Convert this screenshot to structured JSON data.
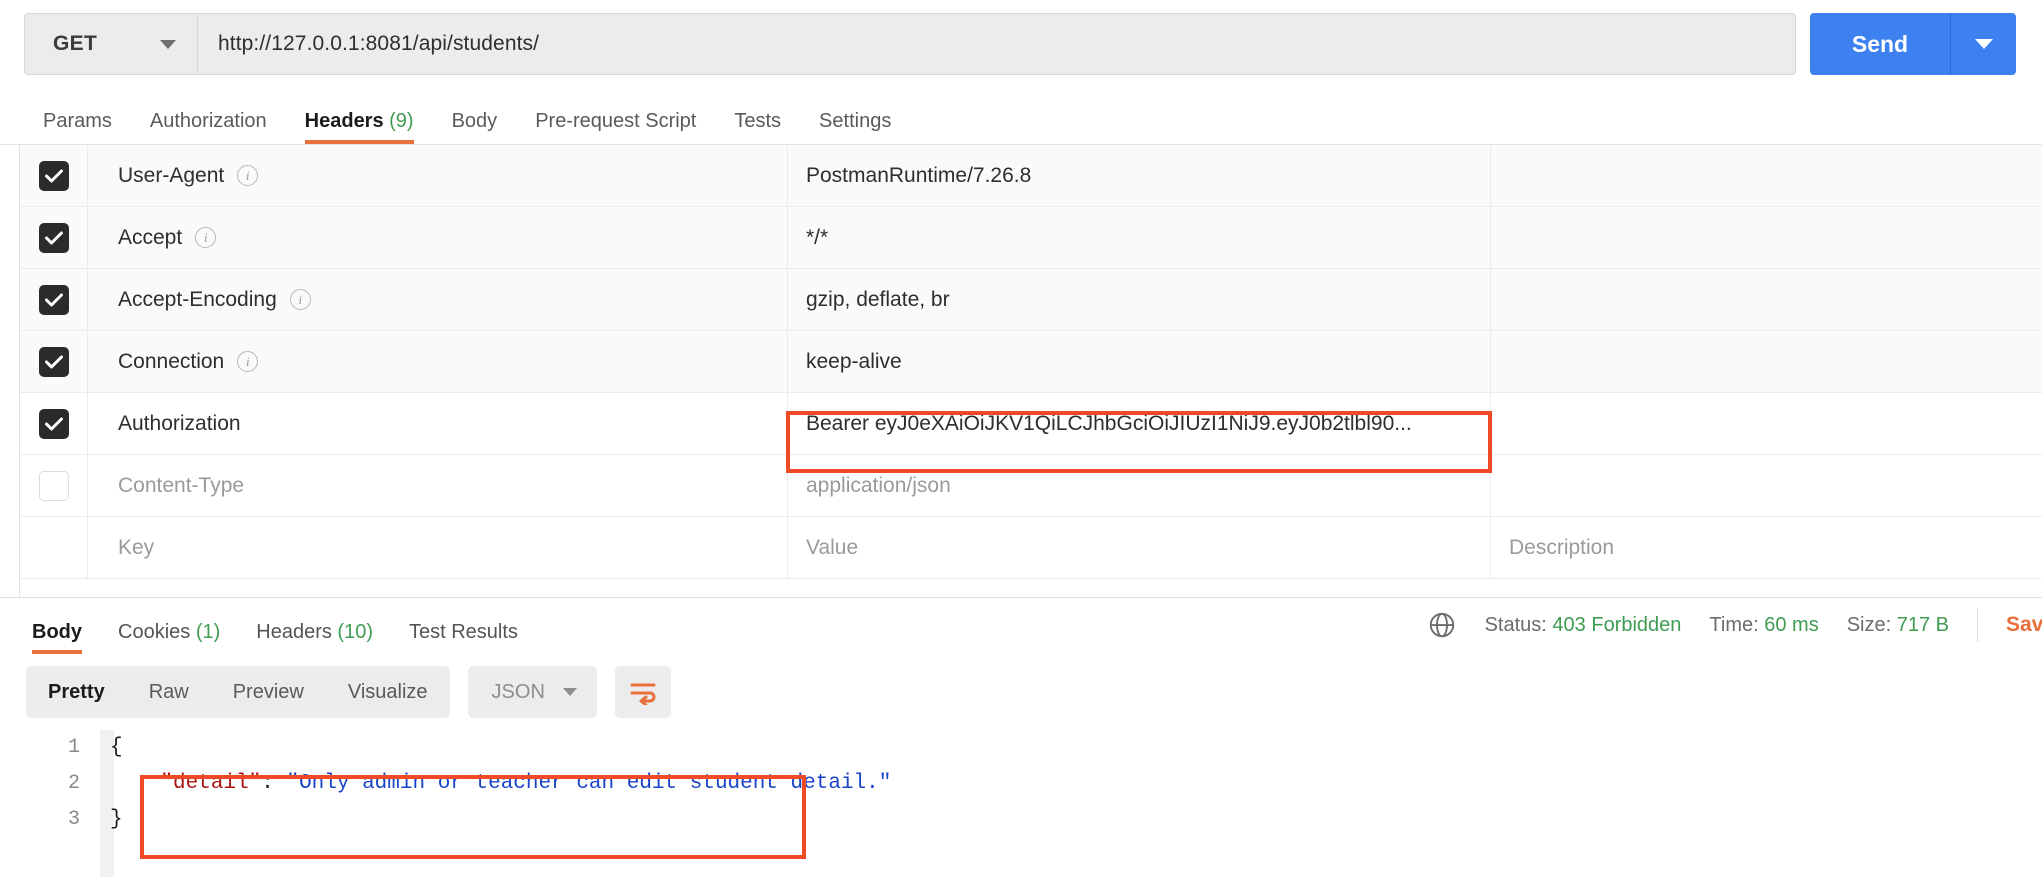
{
  "request": {
    "method": "GET",
    "url": "http://127.0.0.1:8081/api/students/",
    "send_label": "Send",
    "tabs": [
      {
        "label": "Params",
        "count": "",
        "active": false
      },
      {
        "label": "Authorization",
        "count": "",
        "active": false
      },
      {
        "label": "Headers",
        "count": "(9)",
        "active": true
      },
      {
        "label": "Body",
        "count": "",
        "active": false
      },
      {
        "label": "Pre-request Script",
        "count": "",
        "active": false
      },
      {
        "label": "Tests",
        "count": "",
        "active": false
      },
      {
        "label": "Settings",
        "count": "",
        "active": false
      }
    ]
  },
  "headers_table": {
    "columns": [
      "Key",
      "Value",
      "Description"
    ],
    "placeholder_row": {
      "key": "Key",
      "value": "Value",
      "description": "Description"
    },
    "rows": [
      {
        "checked": true,
        "key": "User-Agent",
        "info": true,
        "value": "PostmanRuntime/7.26.8",
        "description": "",
        "dim": false,
        "highlight": false
      },
      {
        "checked": true,
        "key": "Accept",
        "info": true,
        "value": "*/*",
        "description": "",
        "dim": false,
        "highlight": false
      },
      {
        "checked": true,
        "key": "Accept-Encoding",
        "info": true,
        "value": "gzip, deflate, br",
        "description": "",
        "dim": false,
        "highlight": false
      },
      {
        "checked": true,
        "key": "Connection",
        "info": true,
        "value": "keep-alive",
        "description": "",
        "dim": false,
        "highlight": false
      },
      {
        "checked": true,
        "key": "Authorization",
        "info": false,
        "value": "Bearer eyJ0eXAiOiJKV1QiLCJhbGciOiJIUzI1NiJ9.eyJ0b2tlbl90...",
        "description": "",
        "dim": false,
        "highlight": true
      },
      {
        "checked": false,
        "key": "Content-Type",
        "info": false,
        "value": "application/json",
        "description": "",
        "dim": true,
        "highlight": false
      }
    ]
  },
  "response": {
    "tabs": [
      {
        "label": "Body",
        "count": "",
        "active": true
      },
      {
        "label": "Cookies",
        "count": "(1)",
        "active": false
      },
      {
        "label": "Headers",
        "count": "(10)",
        "active": false
      },
      {
        "label": "Test Results",
        "count": "",
        "active": false
      }
    ],
    "status_label": "Status:",
    "status_value": "403 Forbidden",
    "time_label": "Time:",
    "time_value": "60 ms",
    "size_label": "Size:",
    "size_value": "717 B",
    "save_label": "Save Response",
    "body_views": [
      {
        "label": "Pretty",
        "active": true
      },
      {
        "label": "Raw",
        "active": false
      },
      {
        "label": "Preview",
        "active": false
      },
      {
        "label": "Visualize",
        "active": false
      }
    ],
    "format": "JSON",
    "code": {
      "line_numbers": [
        "1",
        "2",
        "3"
      ],
      "lines": [
        {
          "indent": 0,
          "parts": [
            {
              "t": "brace",
              "s": "{"
            }
          ]
        },
        {
          "indent": 1,
          "parts": [
            {
              "t": "key",
              "s": "\"detail\""
            },
            {
              "t": "colon",
              "s": ":"
            },
            {
              "t": "plain",
              "s": " "
            },
            {
              "t": "str",
              "s": "\"Only admin or teacher can edit student detail.\""
            }
          ]
        },
        {
          "indent": 0,
          "parts": [
            {
              "t": "brace",
              "s": "}"
            }
          ]
        }
      ]
    }
  },
  "colors": {
    "accent_orange": "#e8703a",
    "annotation_red": "#ef4a26",
    "send_blue": "#3c81ef",
    "status_green": "#3f9c52"
  }
}
